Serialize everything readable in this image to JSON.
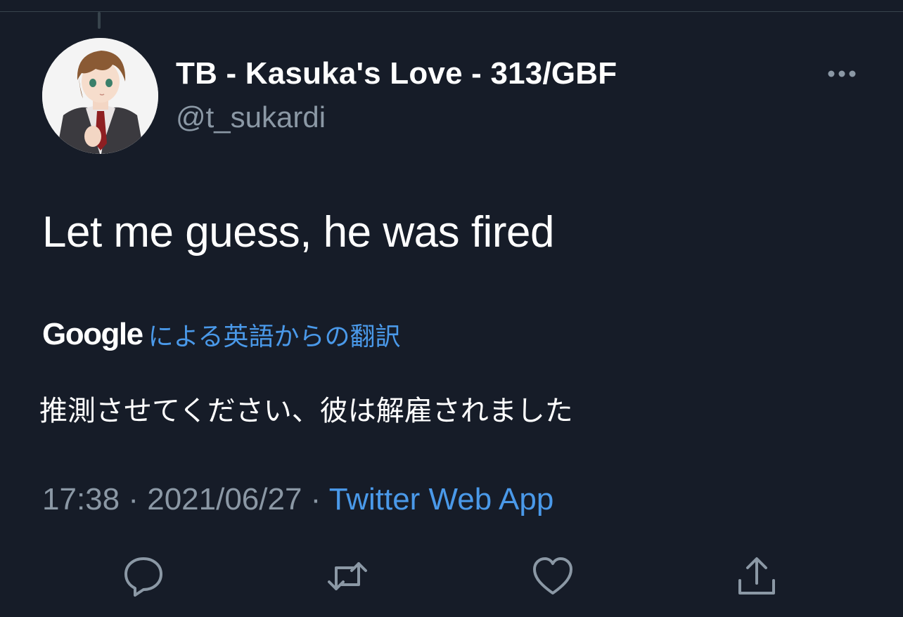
{
  "author": {
    "display_name": "TB - Kasuka's Love - 313/GBF",
    "handle": "@t_sukardi"
  },
  "tweet": {
    "text": "Let me guess, he was fired"
  },
  "translation": {
    "provider": "Google",
    "link_label": "による英語からの翻訳",
    "text": "推測させてください、彼は解雇されました"
  },
  "meta": {
    "time": "17:38",
    "separator1": " · ",
    "date": "2021/06/27",
    "separator2": " · ",
    "source": "Twitter Web App"
  },
  "icons": {
    "more": "more-horizontal-icon",
    "reply": "reply-icon",
    "retweet": "retweet-icon",
    "like": "heart-icon",
    "share": "share-icon"
  },
  "colors": {
    "background": "#161c28",
    "text_primary": "#ffffff",
    "text_secondary": "#8b98a5",
    "accent": "#4a99e9",
    "divider": "#38444d"
  }
}
